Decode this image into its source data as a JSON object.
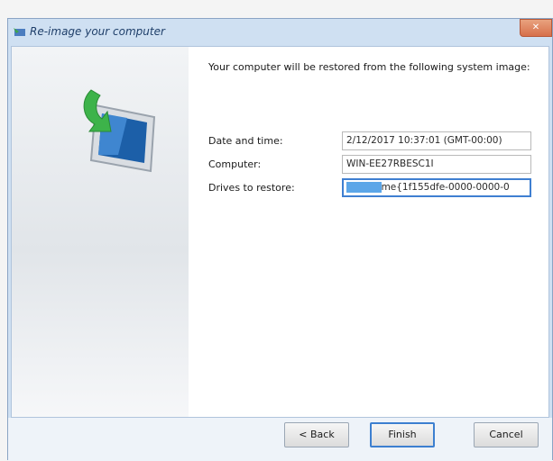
{
  "window": {
    "title": "Re-image your computer",
    "close_symbol": "✕"
  },
  "intro_text": "Your computer will be restored from the following system image:",
  "rows": [
    {
      "label": "Date and time:",
      "value": "2/12/2017 10:37:01 (GMT-00:00)"
    },
    {
      "label": "Computer:",
      "value": "WIN-EE27RBESC1I"
    },
    {
      "label": "Drives to restore:",
      "value_selected": "\\\\?\\Volu",
      "value": "me{1f155dfe-0000-0000-0"
    }
  ],
  "buttons": {
    "back": "< Back",
    "finish": "Finish",
    "cancel": "Cancel"
  },
  "colors": {
    "accent": "#3c7fd0",
    "selection": "#5ca6e8",
    "title_bg": "#cfe0f2"
  }
}
